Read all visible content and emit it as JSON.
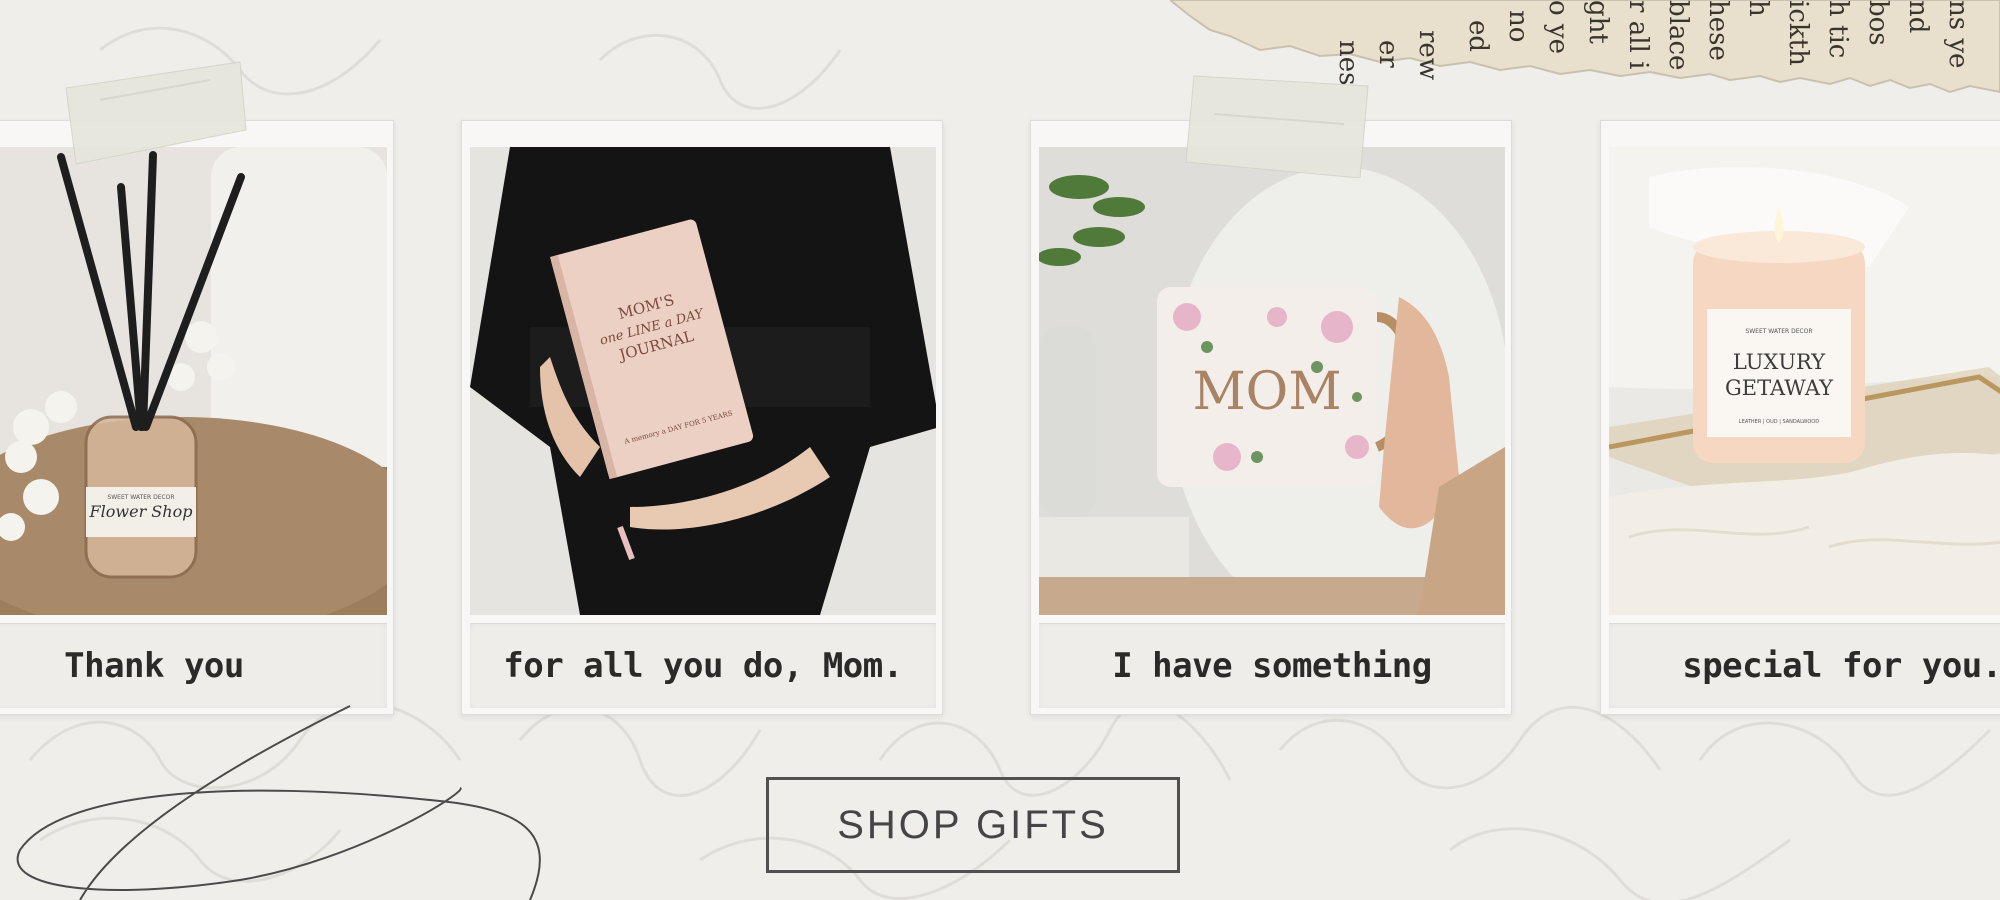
{
  "torn_paper_text": [
    "nes",
    "er",
    "rew",
    "ed",
    "no",
    "o ye",
    "ght",
    "r all i",
    "blace",
    "hese",
    "h",
    "ickth",
    "h tic",
    "bos",
    "nd",
    "ns ye"
  ],
  "photos": [
    {
      "caption": "Thank you",
      "diffuser_label": "Flower Shop",
      "diffuser_brand": "SWEET WATER DECOR"
    },
    {
      "caption": "for all you do, Mom.",
      "journal_title_1": "MOM'S",
      "journal_title_2": "one LINE a DAY",
      "journal_title_3": "JOURNAL",
      "journal_subtitle": "A memory a DAY FOR 5 YEARS"
    },
    {
      "caption": "I have something",
      "mug_text": "MOM"
    },
    {
      "caption": "special for you.",
      "candle_brand": "SWEET WATER DECOR",
      "candle_title_1": "LUXURY",
      "candle_title_2": "GETAWAY",
      "candle_sub": "LEATHER | OUD | SANDALWOOD"
    }
  ],
  "cta": {
    "label": "SHOP GIFTS"
  },
  "colors": {
    "background": "#f0eeeb",
    "button_border": "#505050",
    "caption_text": "#2b2a28",
    "tape": "#e6e6dc"
  }
}
